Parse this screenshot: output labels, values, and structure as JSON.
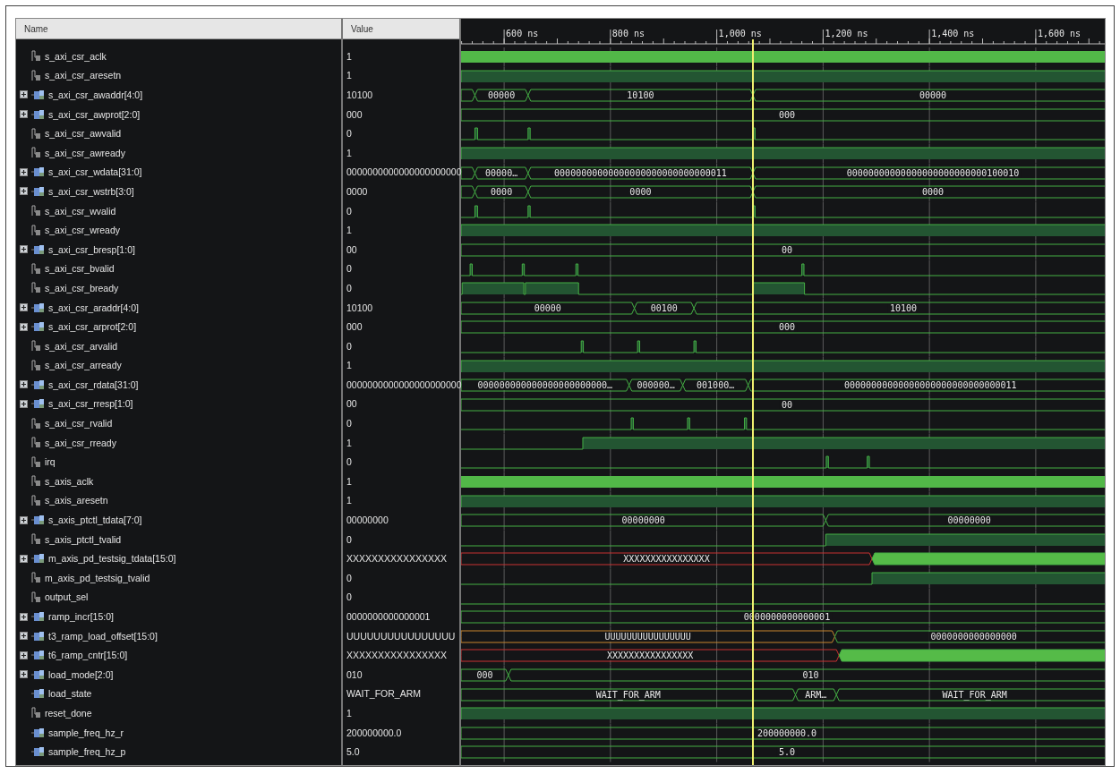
{
  "columns": {
    "name": "Name",
    "value": "Value"
  },
  "timeline": {
    "ticks": [
      "600 ns",
      "800 ns",
      "1,000 ns",
      "1,200 ns",
      "1,400 ns",
      "1,600 ns"
    ]
  },
  "signals": [
    {
      "name": "s_axi_csr_aclk",
      "value": "1",
      "expandable": false,
      "wave": {
        "kind": "clock"
      }
    },
    {
      "name": "s_axi_csr_aresetn",
      "value": "1",
      "expandable": false,
      "wave": {
        "kind": "bit"
      }
    },
    {
      "name": "s_axi_csr_awaddr[4:0]",
      "value": "10100",
      "expandable": true,
      "wave": {
        "kind": "bus",
        "labels": [
          "00000",
          "10100",
          "00000"
        ]
      }
    },
    {
      "name": "s_axi_csr_awprot[2:0]",
      "value": "000",
      "expandable": true,
      "wave": {
        "kind": "bus",
        "labels": [
          "000"
        ]
      }
    },
    {
      "name": "s_axi_csr_awvalid",
      "value": "0",
      "expandable": false,
      "wave": {
        "kind": "bit"
      }
    },
    {
      "name": "s_axi_csr_awready",
      "value": "1",
      "expandable": false,
      "wave": {
        "kind": "bit"
      }
    },
    {
      "name": "s_axi_csr_wdata[31:0]",
      "value": "0000000000000000000000",
      "expandable": true,
      "wave": {
        "kind": "bus",
        "labels": [
          "00000…",
          "00000000000000000000000000000011",
          "00000000000000000000000000100010"
        ]
      }
    },
    {
      "name": "s_axi_csr_wstrb[3:0]",
      "value": "0000",
      "expandable": true,
      "wave": {
        "kind": "bus",
        "labels": [
          "0000",
          "0000",
          "0000"
        ]
      }
    },
    {
      "name": "s_axi_csr_wvalid",
      "value": "0",
      "expandable": false,
      "wave": {
        "kind": "bit"
      }
    },
    {
      "name": "s_axi_csr_wready",
      "value": "1",
      "expandable": false,
      "wave": {
        "kind": "bit"
      }
    },
    {
      "name": "s_axi_csr_bresp[1:0]",
      "value": "00",
      "expandable": true,
      "wave": {
        "kind": "bus",
        "labels": [
          "00"
        ]
      }
    },
    {
      "name": "s_axi_csr_bvalid",
      "value": "0",
      "expandable": false,
      "wave": {
        "kind": "bit"
      }
    },
    {
      "name": "s_axi_csr_bready",
      "value": "0",
      "expandable": false,
      "wave": {
        "kind": "bit"
      }
    },
    {
      "name": "s_axi_csr_araddr[4:0]",
      "value": "10100",
      "expandable": true,
      "wave": {
        "kind": "bus",
        "labels": [
          "00000",
          "00100",
          "10100"
        ]
      }
    },
    {
      "name": "s_axi_csr_arprot[2:0]",
      "value": "000",
      "expandable": true,
      "wave": {
        "kind": "bus",
        "labels": [
          "000"
        ]
      }
    },
    {
      "name": "s_axi_csr_arvalid",
      "value": "0",
      "expandable": false,
      "wave": {
        "kind": "bit"
      }
    },
    {
      "name": "s_axi_csr_arready",
      "value": "1",
      "expandable": false,
      "wave": {
        "kind": "bit"
      }
    },
    {
      "name": "s_axi_csr_rdata[31:0]",
      "value": "0000000000000000000000",
      "expandable": true,
      "wave": {
        "kind": "bus",
        "labels": [
          "000000000000000000000000…",
          "000000…",
          "001000…",
          "00000000000000000000000000000011"
        ]
      }
    },
    {
      "name": "s_axi_csr_rresp[1:0]",
      "value": "00",
      "expandable": true,
      "wave": {
        "kind": "bus",
        "labels": [
          "00"
        ]
      }
    },
    {
      "name": "s_axi_csr_rvalid",
      "value": "0",
      "expandable": false,
      "wave": {
        "kind": "bit"
      }
    },
    {
      "name": "s_axi_csr_rready",
      "value": "1",
      "expandable": false,
      "wave": {
        "kind": "bit"
      }
    },
    {
      "name": "irq",
      "value": "0",
      "expandable": false,
      "wave": {
        "kind": "bit"
      }
    },
    {
      "name": "s_axis_aclk",
      "value": "1",
      "expandable": false,
      "wave": {
        "kind": "clock"
      }
    },
    {
      "name": "s_axis_aresetn",
      "value": "1",
      "expandable": false,
      "wave": {
        "kind": "bit"
      }
    },
    {
      "name": "s_axis_ptctl_tdata[7:0]",
      "value": "00000000",
      "expandable": true,
      "wave": {
        "kind": "bus",
        "labels": [
          "00000000",
          "00000000"
        ]
      }
    },
    {
      "name": "s_axis_ptctl_tvalid",
      "value": "0",
      "expandable": false,
      "wave": {
        "kind": "bit"
      }
    },
    {
      "name": "m_axis_pd_testsig_tdata[15:0]",
      "value": "XXXXXXXXXXXXXXXX",
      "expandable": true,
      "wave": {
        "kind": "bus",
        "labels": [
          "XXXXXXXXXXXXXXXX"
        ]
      }
    },
    {
      "name": "m_axis_pd_testsig_tvalid",
      "value": "0",
      "expandable": false,
      "wave": {
        "kind": "bit"
      }
    },
    {
      "name": "output_sel",
      "value": "0",
      "expandable": false,
      "wave": {
        "kind": "bit"
      }
    },
    {
      "name": "ramp_incr[15:0]",
      "value": "0000000000000001",
      "expandable": true,
      "wave": {
        "kind": "bus",
        "labels": [
          "0000000000000001"
        ]
      }
    },
    {
      "name": "t3_ramp_load_offset[15:0]",
      "value": "UUUUUUUUUUUUUUUU",
      "expandable": true,
      "wave": {
        "kind": "bus",
        "labels": [
          "UUUUUUUUUUUUUUUU",
          "0000000000000000"
        ]
      }
    },
    {
      "name": "t6_ramp_cntr[15:0]",
      "value": "XXXXXXXXXXXXXXXX",
      "expandable": true,
      "wave": {
        "kind": "bus",
        "labels": [
          "XXXXXXXXXXXXXXXX"
        ]
      }
    },
    {
      "name": "load_mode[2:0]",
      "value": "010",
      "expandable": true,
      "wave": {
        "kind": "bus",
        "labels": [
          "000",
          "010"
        ]
      }
    },
    {
      "name": "load_state",
      "value": "WAIT_FOR_ARM",
      "expandable": false,
      "wave": {
        "kind": "bus",
        "labels": [
          "WAIT_FOR_ARM",
          "ARM…",
          "WAIT_FOR_ARM"
        ]
      }
    },
    {
      "name": "reset_done",
      "value": "1",
      "expandable": false,
      "wave": {
        "kind": "bit"
      }
    },
    {
      "name": "sample_freq_hz_r",
      "value": "200000000.0",
      "expandable": false,
      "wave": {
        "kind": "bus",
        "labels": [
          "200000000.0"
        ]
      }
    },
    {
      "name": "sample_freq_hz_p",
      "value": "5.0",
      "expandable": false,
      "wave": {
        "kind": "bus",
        "labels": [
          "5.0"
        ]
      }
    }
  ]
}
